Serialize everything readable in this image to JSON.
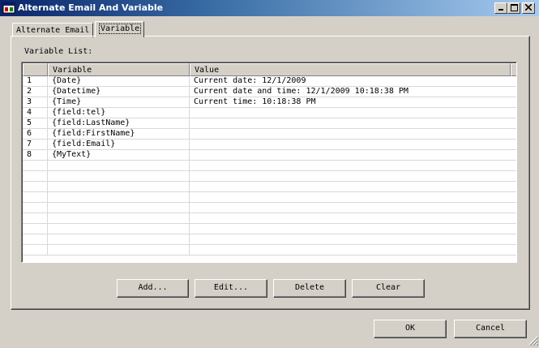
{
  "window": {
    "title": "Alternate Email And Variable"
  },
  "tabs": [
    {
      "label": "Alternate Email"
    },
    {
      "label": "Variable"
    }
  ],
  "panel": {
    "list_label": "Variable List:"
  },
  "grid": {
    "columns": [
      "Variable",
      "Value"
    ],
    "rows": [
      {
        "num": "1",
        "variable": "{Date}",
        "value": "Current date: 12/1/2009"
      },
      {
        "num": "2",
        "variable": "{Datetime}",
        "value": "Current date and time: 12/1/2009 10:18:38 PM"
      },
      {
        "num": "3",
        "variable": "{Time}",
        "value": "Current time: 10:18:38 PM"
      },
      {
        "num": "4",
        "variable": "{field:tel}",
        "value": ""
      },
      {
        "num": "5",
        "variable": "{field:LastName}",
        "value": ""
      },
      {
        "num": "6",
        "variable": "{field:FirstName}",
        "value": ""
      },
      {
        "num": "7",
        "variable": "{field:Email}",
        "value": ""
      },
      {
        "num": "8",
        "variable": "{MyText}",
        "value": ""
      }
    ]
  },
  "buttons": {
    "add": "Add...",
    "edit": "Edit...",
    "delete": "Delete",
    "clear": "Clear",
    "ok": "OK",
    "cancel": "Cancel"
  }
}
